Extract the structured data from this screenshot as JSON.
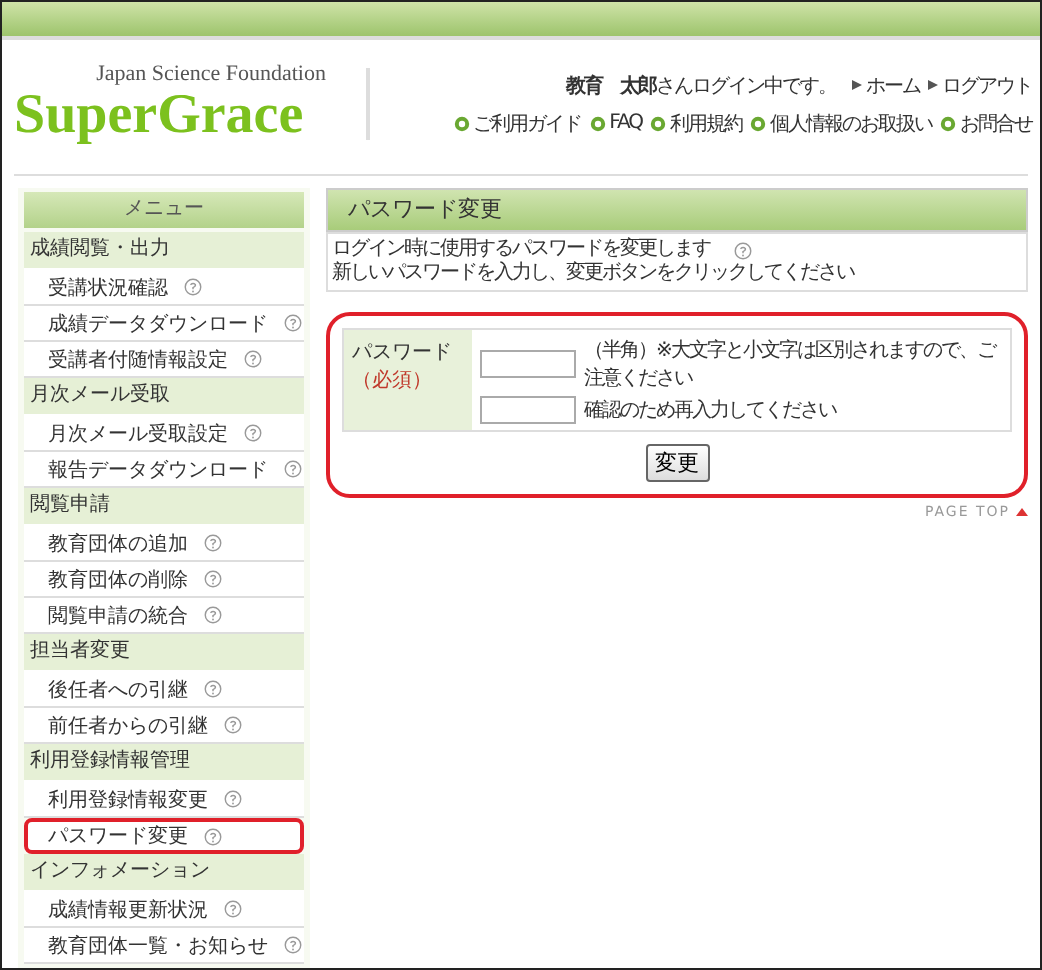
{
  "header": {
    "org": "Japan Science Foundation",
    "logo": "SuperGrace",
    "user_name": "教育　太郎",
    "user_suffix": "さんログイン中です。",
    "top_links": [
      "ホーム",
      "ログアウト"
    ],
    "sub_links": [
      "ご利用ガイド",
      "FAQ",
      "利用規約",
      "個人情報のお取扱い",
      "お問合せ"
    ]
  },
  "sidebar": {
    "title": "メニュー",
    "sections": [
      {
        "title": "成績閲覧・出力",
        "children": [
          {
            "label": "受講状況確認",
            "highlighted": false
          },
          {
            "label": "成績データダウンロード",
            "highlighted": false
          },
          {
            "label": "受講者付随情報設定",
            "highlighted": false
          }
        ]
      },
      {
        "title": "月次メール受取",
        "children": [
          {
            "label": "月次メール受取設定",
            "highlighted": false
          },
          {
            "label": "報告データダウンロード",
            "highlighted": false
          }
        ]
      },
      {
        "title": "閲覧申請",
        "children": [
          {
            "label": "教育団体の追加",
            "highlighted": false
          },
          {
            "label": "教育団体の削除",
            "highlighted": false
          },
          {
            "label": "閲覧申請の統合",
            "highlighted": false
          }
        ]
      },
      {
        "title": "担当者変更",
        "children": [
          {
            "label": "後任者への引継",
            "highlighted": false
          },
          {
            "label": "前任者からの引継",
            "highlighted": false
          }
        ]
      },
      {
        "title": "利用登録情報管理",
        "children": [
          {
            "label": "利用登録情報変更",
            "highlighted": false
          },
          {
            "label": "パスワード変更",
            "highlighted": true
          }
        ]
      },
      {
        "title": "インフォメーション",
        "children": [
          {
            "label": "成績情報更新状況",
            "highlighted": false
          },
          {
            "label": "教育団体一覧・お知らせ",
            "highlighted": false
          }
        ]
      }
    ]
  },
  "main": {
    "title": "パスワード変更",
    "intro": [
      "ログイン時に使用するパスワードを変更します",
      "新しいパスワードを入力し、変更ボタンをクリックしてください"
    ],
    "form": {
      "highlighted": true,
      "label": "パスワード",
      "required": "（必須）",
      "fields": [
        {
          "note": "（半角）※大文字と小文字は区別されますので、ご注意ください"
        },
        {
          "note": "確認のため再入力してください"
        }
      ],
      "button": "変更"
    },
    "page_top": "PAGE TOP"
  }
}
